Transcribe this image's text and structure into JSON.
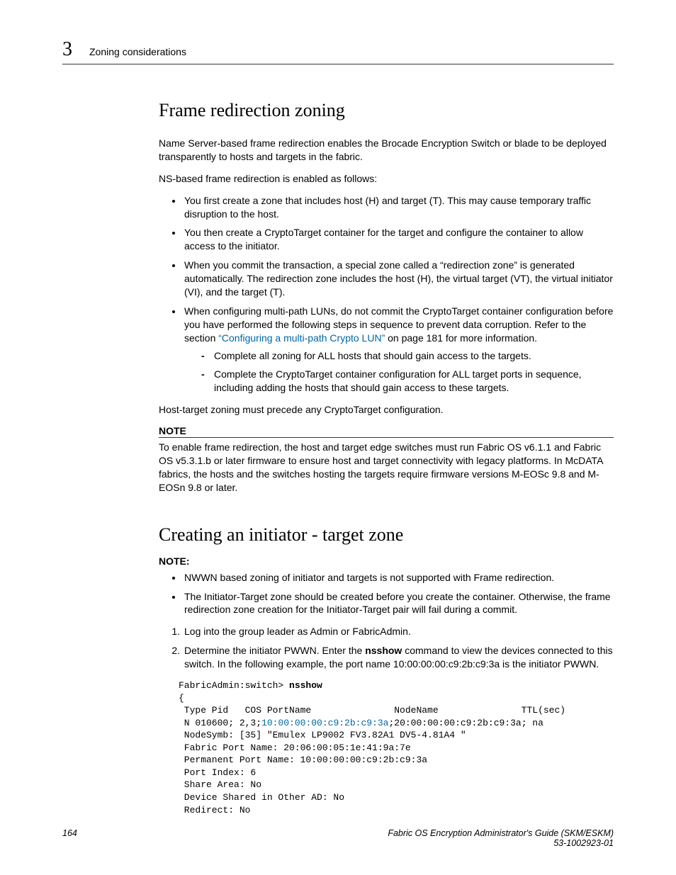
{
  "header": {
    "chapter_number": "3",
    "running_title": "Zoning considerations"
  },
  "section1": {
    "title": "Frame redirection zoning",
    "intro": "Name Server-based frame redirection enables the Brocade Encryption Switch or blade to be deployed transparently to hosts and targets in the fabric.",
    "enabled_as": "NS-based frame redirection is enabled as follows:",
    "bullets": {
      "b1": "You first create a zone that includes host (H) and target (T). This may cause temporary traffic disruption to the host.",
      "b2": "You then create a CryptoTarget container for the target and configure the container to allow access to the initiator.",
      "b3": "When you commit the transaction, a special zone called a “redirection zone” is generated automatically. The redirection zone includes the host (H), the virtual target (VT), the virtual initiator (VI), and the target (T).",
      "b4_pre": "When configuring multi-path LUNs, do not commit the CryptoTarget container configuration before you have performed the following steps in sequence to prevent data corruption. Refer to the section ",
      "b4_link": "“Configuring a multi-path Crypto LUN”",
      "b4_post": " on page 181 for more information.",
      "b4_sub1": "Complete all zoning for ALL hosts that should gain access to the targets.",
      "b4_sub2": "Complete the CryptoTarget container configuration for ALL target ports in sequence, including adding the hosts that should gain access to these targets."
    },
    "post_list": "Host-target zoning must precede any CryptoTarget configuration.",
    "note_label": "NOTE",
    "note_body": "To enable frame redirection, the host and target edge switches must run Fabric OS v6.1.1 and Fabric OS v5.3.1.b or later firmware to ensure host and target connectivity with legacy platforms. In McDATA fabrics, the hosts and the switches hosting the targets require firmware versions M-EOSc 9.8 and M-EOSn 9.8 or later."
  },
  "section2": {
    "title": "Creating an initiator - target zone",
    "note_label": "NOTE:",
    "note_b1": "NWWN based zoning of initiator and targets is not supported with Frame redirection.",
    "note_b2": "The Initiator-Target zone should be created before you create the container. Otherwise, the frame redirection zone creation for the Initiator-Target pair will fail during a commit.",
    "step1": "Log into the group leader as Admin or FabricAdmin.",
    "step2_pre": "Determine the initiator PWWN. Enter the ",
    "step2_cmd": "nsshow",
    "step2_post": " command to view the devices connected to this switch. In the following example, the port name 10:00:00:00:c9:2b:c9:3a is the initiator PWWN.",
    "code": {
      "prompt": "FabricAdmin:switch> ",
      "cmd": "nsshow",
      "l_open": "{",
      "l_head": " Type Pid   COS PortName               NodeName               TTL(sec)",
      "l_row_pre": " N 010600; 2,3;",
      "l_row_hl": "10:00:00:00:c9:2b:c9:3a",
      "l_row_post": ";20:00:00:00:c9:2b:c9:3a; na",
      "l_nodesymb": " NodeSymb: [35] \"Emulex LP9002 FV3.82A1 DV5-4.81A4 \"",
      "l_fpn": " Fabric Port Name: 20:06:00:05:1e:41:9a:7e",
      "l_ppn": " Permanent Port Name: 10:00:00:00:c9:2b:c9:3a",
      "l_pi": " Port Index: 6",
      "l_sa": " Share Area: No",
      "l_ds": " Device Shared in Other AD: No",
      "l_rd": " Redirect: No"
    }
  },
  "footer": {
    "page": "164",
    "doc_title": "Fabric OS Encryption Administrator's Guide (SKM/ESKM)",
    "doc_num": "53-1002923-01"
  }
}
